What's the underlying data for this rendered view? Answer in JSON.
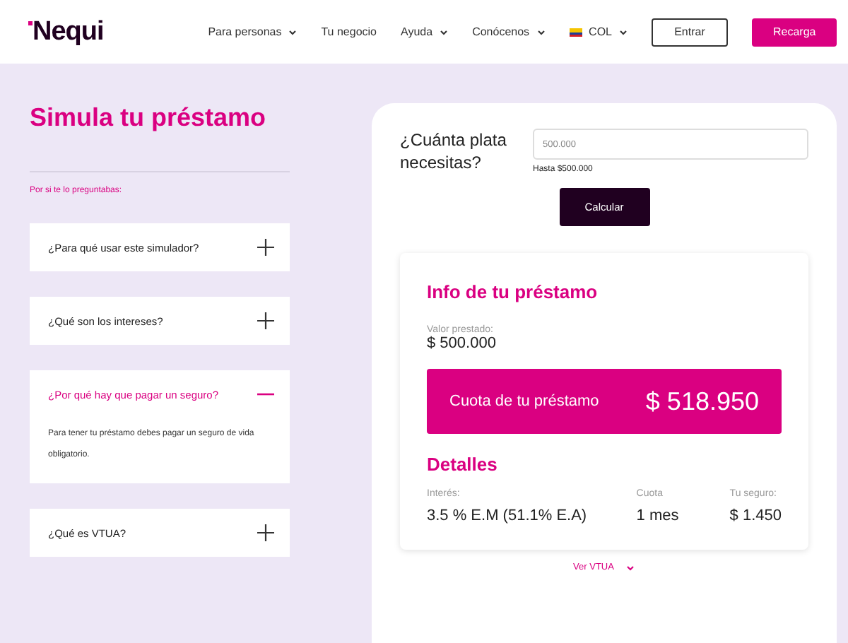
{
  "header": {
    "logo": "Nequi",
    "nav": [
      {
        "label": "Para personas",
        "dropdown": true
      },
      {
        "label": "Tu negocio",
        "dropdown": false
      },
      {
        "label": "Ayuda",
        "dropdown": true
      },
      {
        "label": "Conócenos",
        "dropdown": true
      }
    ],
    "country": "COL",
    "buttons": [
      {
        "label": "Entrar",
        "kind": "outline"
      },
      {
        "label": "Recarga",
        "kind": "filled"
      }
    ]
  },
  "title": "Simula tu préstamo",
  "faq_intro": "Por si te lo preguntabas:",
  "faq": [
    {
      "question": "¿Para qué usar este simulador?",
      "expanded": false
    },
    {
      "question": "¿Qué son los intereses?",
      "expanded": false
    },
    {
      "question": "¿Por qué hay que pagar un seguro?",
      "expanded": true,
      "answer": "Para tener tu préstamo debes pagar un seguro de vida obligatorio."
    },
    {
      "question": "¿Qué es VTUA?",
      "expanded": false
    }
  ],
  "simulator": {
    "question": "¿Cuánta plata necesitas?",
    "amount": "500.000",
    "hint": "Hasta $500.000",
    "button": "Calcular",
    "info": {
      "title": "Info de tu préstamo",
      "lent_label": "Valor prestado:",
      "lent_value": "$ 500.000",
      "fee_label": "Cuota de tu préstamo",
      "fee_value": "$ 518.950",
      "details_title": "Detalles",
      "details": [
        {
          "label": "Interés:",
          "value": "3.5 % E.M (51.1% E.A)"
        },
        {
          "label": "Cuota",
          "value": "1 mes"
        },
        {
          "label": "Tu seguro:",
          "value": "$ 1.450"
        }
      ]
    },
    "more_link": "Ver VTUA"
  }
}
